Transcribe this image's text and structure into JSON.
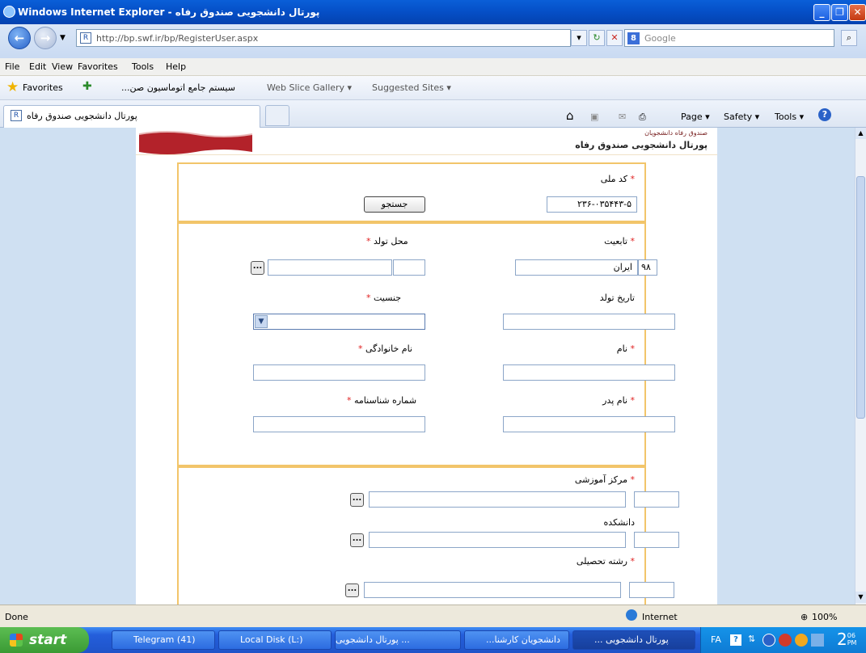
{
  "window": {
    "title": "Windows Internet Explorer - پورتال دانشجویی صندوق رفاه"
  },
  "address": {
    "url": "http://bp.swf.ir/bp/RegisterUser.aspx",
    "search_placeholder": "Google"
  },
  "menu": {
    "items": [
      "File",
      "Edit",
      "View",
      "Favorites",
      "Tools",
      "Help"
    ]
  },
  "favorites": {
    "label": "Favorites",
    "item1": "...سیستم جامع اتوماسیون صن",
    "item2": "Web Slice Gallery ▾",
    "item3": "Suggested Sites ▾"
  },
  "tab": {
    "title": "پورتال دانشجویی صندوق رفاه",
    "page_label": "Page ▾",
    "safety_label": "Safety ▾",
    "tools_label": "Tools ▾"
  },
  "site": {
    "small_title": "صندوق رفاه دانشجویان",
    "main_title": "پورتال دانشجویی صندوق رفاه"
  },
  "form": {
    "national_code_label": "کد ملی",
    "national_code_value": "۲۳۶-۰۳۵۴۴۳-۵",
    "search_button": "جستجو",
    "nationality_label": "تابعیت",
    "nationality_code": "۹۸",
    "nationality_value": "ایران",
    "birthplace_label": "محل تولد",
    "birthdate_label": "تاریخ تولد",
    "gender_label": "جنسیت",
    "first_name_label": "نام",
    "last_name_label": "نام خانوادگی",
    "father_name_label": "نام پدر",
    "id_number_label": "شماره شناسنامه",
    "center_label": "مرکز آموزشی",
    "faculty_label": "دانشکده",
    "major_label": "رشته تحصیلی",
    "required_mark": "*",
    "lookup_button": "..."
  },
  "status": {
    "left": "Done",
    "zone": "Internet",
    "zoom": "100%"
  },
  "taskbar": {
    "start": "start",
    "items": [
      "Telegram (41)",
      "Local Disk (L:)",
      "... پورتال دانشجویی",
      "...دانشجویان کارشنا",
      "... پورتال دانشجویی"
    ],
    "lang": "FA",
    "clock_hour": "2",
    "clock_min": "06",
    "clock_ampm": "PM"
  }
}
